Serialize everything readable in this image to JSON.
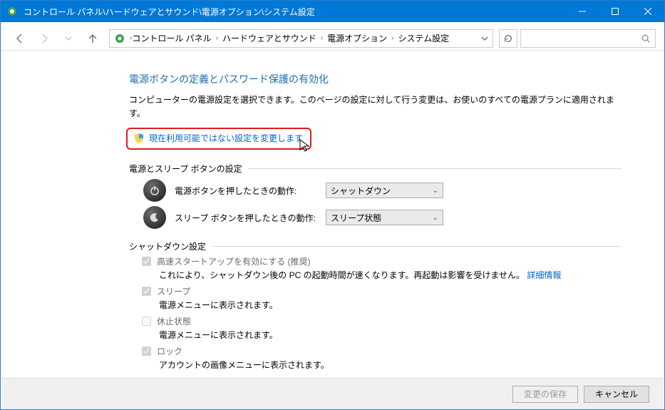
{
  "window": {
    "title": "コントロール パネル\\ハードウェアとサウンド\\電源オプション\\システム設定"
  },
  "breadcrumb": {
    "items": [
      "コントロール パネル",
      "ハードウェアとサウンド",
      "電源オプション",
      "システム設定"
    ]
  },
  "page": {
    "title": "電源ボタンの定義とパスワード保護の有効化",
    "description": "コンピューターの電源設定を選択できます。このページの設定に対して行う変更は、お使いのすべての電源プランに適用されます。",
    "change_link": "現在利用可能ではない設定を変更します"
  },
  "power_sleep": {
    "section": "電源とスリープ ボタンの設定",
    "power_btn_label": "電源ボタンを押したときの動作:",
    "power_btn_value": "シャットダウン",
    "sleep_btn_label": "スリープ ボタンを押したときの動作:",
    "sleep_btn_value": "スリープ状態"
  },
  "shutdown": {
    "section": "シャットダウン設定",
    "fast_startup": "高速スタートアップを有効にする (推奨)",
    "fast_startup_desc": "これにより、シャットダウン後の PC の起動時間が速くなります。再起動は影響を受けません。",
    "fast_startup_link": "詳細情報",
    "sleep": "スリープ",
    "sleep_desc": "電源メニューに表示されます。",
    "hibernate": "休止状態",
    "hibernate_desc": "電源メニューに表示されます。",
    "lock": "ロック",
    "lock_desc": "アカウントの画像メニューに表示されます。"
  },
  "footer": {
    "save": "変更の保存",
    "cancel": "キャンセル"
  }
}
